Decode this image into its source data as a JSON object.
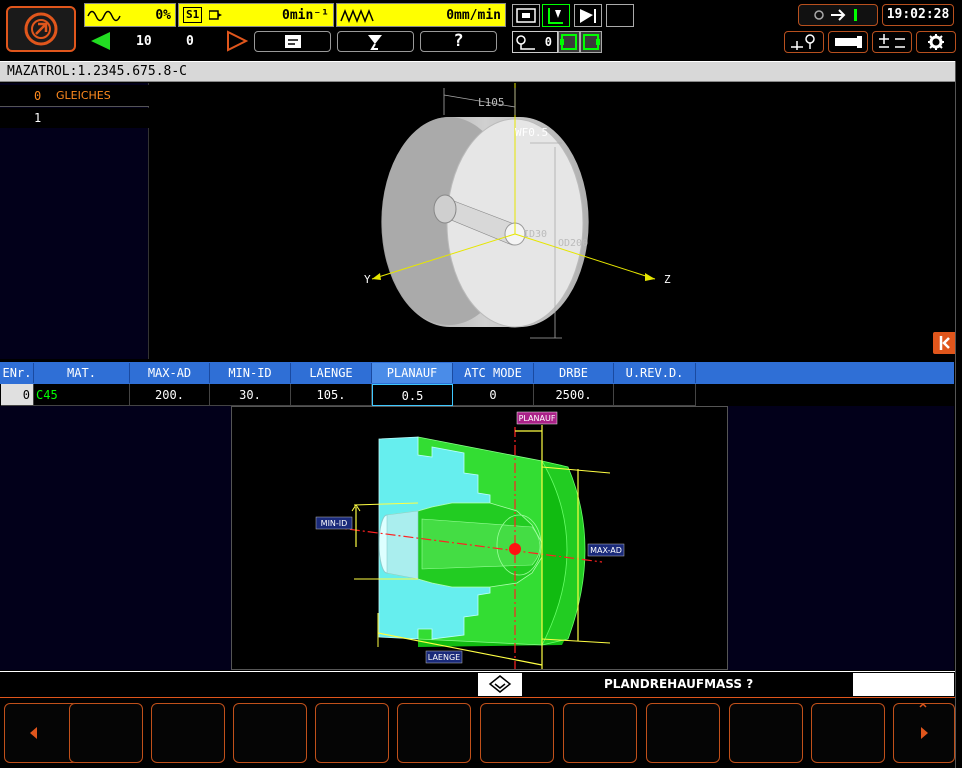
{
  "header": {
    "spindle_load": "0%",
    "spindle_label": "S1",
    "spindle_speed": "0min⁻¹",
    "feed_rate": "0mm/min",
    "clock": "19:02:28",
    "counter_a": "10",
    "counter_b": "0",
    "tool_number": "0",
    "help_label": "?"
  },
  "program_bar": {
    "title": "MAZATROL:1.2345.675.8-C"
  },
  "unit_list": [
    {
      "number": "0",
      "label": "GLEICHES"
    },
    {
      "number": "1",
      "label": ""
    }
  ],
  "viewport": {
    "dim_length": "L105",
    "dim_wf": "WF0.5",
    "dim_id": "ID30",
    "dim_od": "OD200",
    "axis_y": "Y",
    "axis_z": "Z"
  },
  "table": {
    "headers": [
      "ENr.",
      "MAT.",
      "MAX-AD",
      "MIN-ID",
      "LAENGE",
      "PLANAUF",
      "ATC MODE",
      "DRBE",
      "U.REV.D."
    ],
    "row": [
      "0",
      "C45",
      "200.",
      "30.",
      "105.",
      "0.5",
      "0",
      "2500.",
      ""
    ]
  },
  "diagram": {
    "planauf": "PLANAUF",
    "min_id": "MIN-ID",
    "max_ad": "MAX-AD",
    "laenge": "LAENGE"
  },
  "prompt": {
    "text": "PLANDREHAUFMASS ?",
    "input": ""
  },
  "colors": {
    "accent": "#e0561c",
    "yellow": "#ffff00",
    "table_header": "#2f6fd6",
    "material_green": "#00ff00"
  }
}
